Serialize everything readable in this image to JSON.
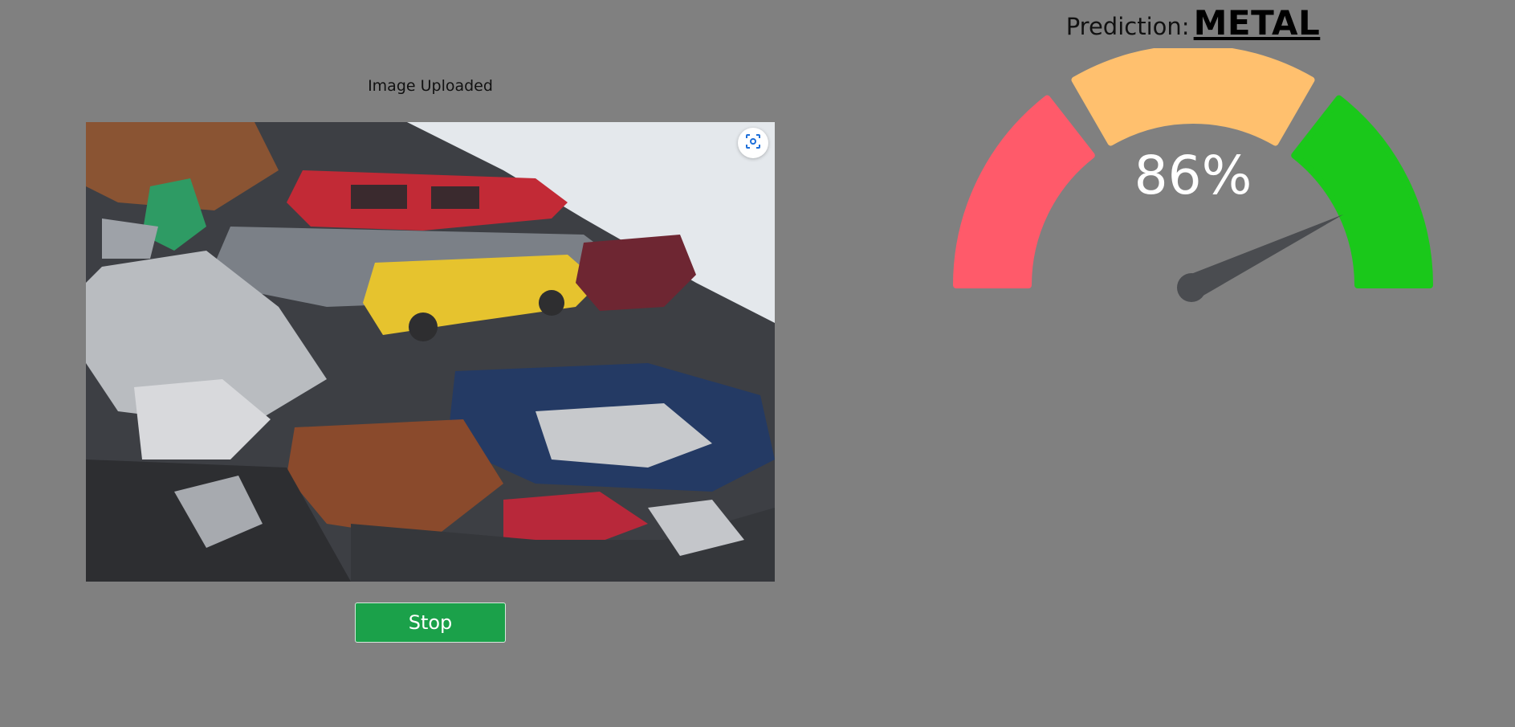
{
  "upload": {
    "caption": "Image Uploaded",
    "image_alt": "Pile of crushed scrap cars and metal"
  },
  "controls": {
    "stop_label": "Stop",
    "screenshot_icon": "screenshot-scan-icon"
  },
  "prediction": {
    "label": "Prediction:",
    "value": "METAL"
  },
  "gauge": {
    "value_percent": 86,
    "value_text": "86%",
    "segments": [
      {
        "name": "low",
        "color": "#ff5a6a"
      },
      {
        "name": "mid",
        "color": "#ffc06e"
      },
      {
        "name": "high",
        "color": "#1ac81a"
      }
    ],
    "needle_color": "#4a4c50"
  },
  "colors": {
    "background": "#808080",
    "stop_button": "#1ba14a"
  }
}
